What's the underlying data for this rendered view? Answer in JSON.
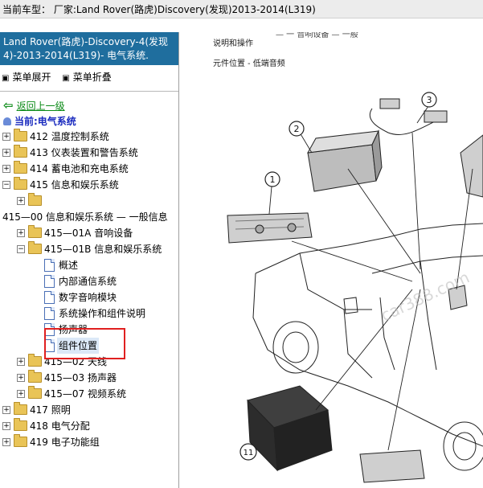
{
  "titlebar": {
    "text": "当前车型：  厂家:Land Rover(路虎)Discovery(发现)2013-2014(L319)"
  },
  "sidebar": {
    "header": "Land Rover(路虎)-Discovery-4(发现4)-2013-2014(L319)- 电气系统.",
    "expand_all": "菜单展开",
    "collapse_all": "菜单折叠",
    "back": "返回上一级",
    "current": "当前:电气系统",
    "tree": {
      "n412": "412 温度控制系统",
      "n413": "413 仪表装置和警告系统",
      "n414": "414 蓄电池和充电系统",
      "n415": "415 信息和娱乐系统",
      "n415_00": "415—00 信息和娱乐系统 — 一般信息",
      "n415_01a": "415—01A 音响设备",
      "n415_01b": "415—01B 信息和娱乐系统",
      "d1": "概述",
      "d2": "内部通信系统",
      "d3": "数字音响模块",
      "d4": "系统操作和组件说明",
      "d5": "扬声器",
      "d6": "组件位置",
      "n415_02": "415—02 天线",
      "n415_03": "415—03 扬声器",
      "n415_07": "415—07 视频系统",
      "n417": "417 照明",
      "n418": "418 电气分配",
      "n419": "419 电子功能组"
    }
  },
  "content": {
    "top_cut": "— 一 音响设备 — 一般",
    "page_title": "说明和操作",
    "section_title": "元件位置 - 低端音频",
    "callouts": [
      "1",
      "2",
      "3",
      "11"
    ],
    "watermark": "car388.com"
  }
}
